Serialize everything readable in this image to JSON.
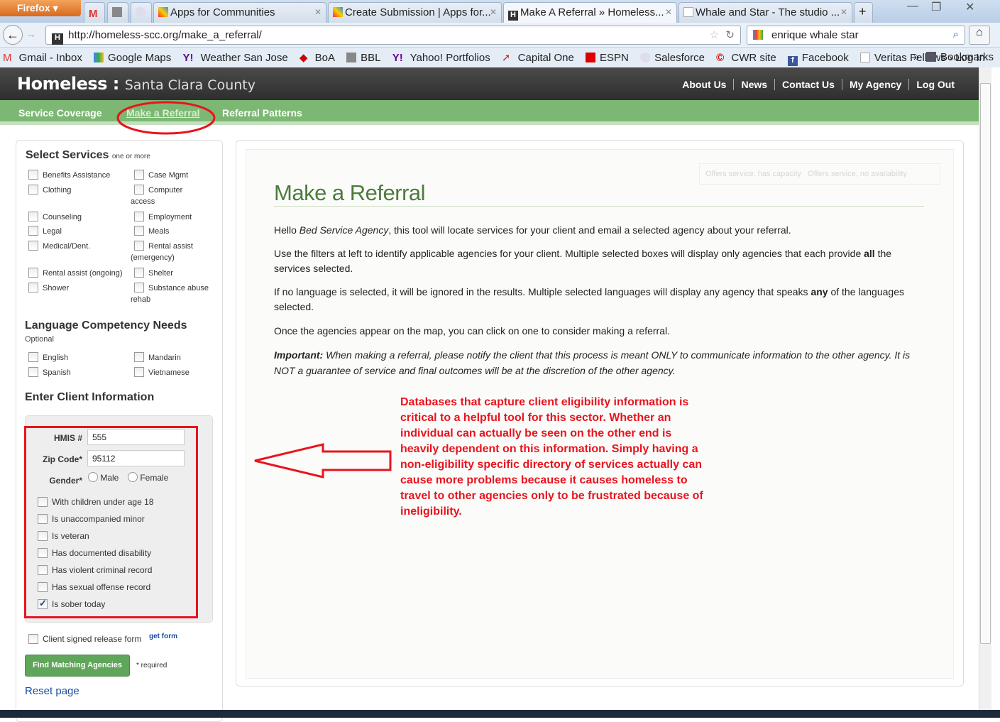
{
  "browser": {
    "app_button": "Firefox",
    "tabs": [
      {
        "label": ""
      },
      {
        "label": ""
      },
      {
        "label": ""
      },
      {
        "label": "Apps for Communities"
      },
      {
        "label": "Create Submission | Apps for..."
      },
      {
        "label": "Make A Referral » Homeless..."
      },
      {
        "label": "Whale and Star - The studio ..."
      }
    ],
    "new_tab": "+",
    "url": "http://homeless-scc.org/make_a_referral/",
    "search_value": "enrique whale star",
    "bookmarks": [
      "Gmail - Inbox",
      "Google Maps",
      "Weather San Jose",
      "BoA",
      "BBL",
      "Yahoo! Portfolios",
      "Capital One",
      "ESPN",
      "Salesforce",
      "CWR site",
      "Facebook",
      "Veritas Fellows › Log In"
    ],
    "bookmarks_more": "»",
    "bookmarks_menu": "Bookmarks"
  },
  "site": {
    "logo_main": "Homeless :",
    "logo_sub": "Santa Clara County",
    "top_links": [
      "About Us",
      "News",
      "Contact Us",
      "My Agency",
      "Log Out"
    ],
    "nav": [
      "Service Coverage",
      "Make a Referral",
      "Referral Patterns"
    ]
  },
  "sidebar": {
    "services_title": "Select Services",
    "services_hint": "one or more",
    "services": [
      "Benefits Assistance",
      "Case Mgmt",
      "Clothing",
      "Computer",
      "access",
      "Counseling",
      "Employment",
      "Legal",
      "Meals",
      "Medical/Dent.",
      "Rental assist",
      "(emergency)",
      "Rental assist (ongoing)",
      "Shelter",
      "Shower",
      "Substance abuse",
      "rehab"
    ],
    "language_title": "Language Competency Needs",
    "language_hint": "Optional",
    "languages": [
      "English",
      "Mandarin",
      "Spanish",
      "Vietnamese"
    ],
    "client_title": "Enter Client Information",
    "hmis_label": "HMIS #",
    "hmis_value": "555",
    "zip_label": "Zip Code*",
    "zip_value": "95112",
    "gender_label": "Gender*",
    "gender_options": [
      "Male",
      "Female"
    ],
    "client_checks": [
      {
        "label": "With children under age 18",
        "checked": false
      },
      {
        "label": "Is unaccompanied minor",
        "checked": false
      },
      {
        "label": "Is veteran",
        "checked": false
      },
      {
        "label": "Has documented disability",
        "checked": false
      },
      {
        "label": "Has violent criminal record",
        "checked": false
      },
      {
        "label": "Has sexual offense record",
        "checked": false
      },
      {
        "label": "Is sober today",
        "checked": true
      }
    ],
    "release_label": "Client signed release form",
    "get_form": "get form",
    "find_button": "Find Matching Agencies",
    "required": "* required",
    "reset": "Reset page"
  },
  "main": {
    "legend": [
      "Offers service, has capacity",
      "Offers service, no availability"
    ],
    "title": "Make a Referral",
    "p1_a": "Hello ",
    "p1_agency": "Bed Service Agency",
    "p1_b": ", this tool will locate services for your client and email a selected agency about your referral.",
    "p2_a": "Use the filters at left to identify applicable agencies for your client. Multiple selected boxes will display only agencies that each provide ",
    "p2_bold": "all",
    "p2_b": " the services selected.",
    "p3_a": "If no language is selected, it will be ignored in the results. Multiple selected languages will display any agency that speaks ",
    "p3_bold": "any",
    "p3_b": " of the languages selected.",
    "p4": "Once the agencies appear on the map, you can click on one to consider making a referral.",
    "p5_label": "Important:",
    "p5": " When making a referral, please notify the client that this process is meant ONLY to communicate information to the other agency. It is NOT a guarantee of service and final outcomes will be at the discretion of the other agency."
  },
  "annotation": {
    "note": "Databases that capture client eligibility information is critical to a helpful tool for this sector.  Whether an individual can actually be seen on the other end is heavily dependent on this information.  Simply having a non-eligibility specific directory of services actually can cause more problems because it causes homeless to travel to other agencies only to be frustrated because of ineligibility.",
    "color": "#e8141e"
  }
}
